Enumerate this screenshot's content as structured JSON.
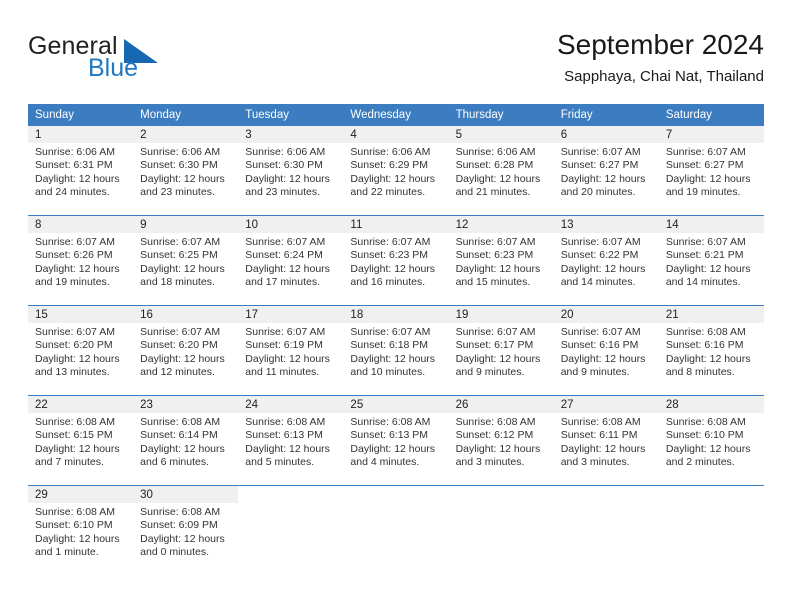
{
  "brand": {
    "name_part1": "General",
    "name_part2": "Blue",
    "accent_color": "#1668b3",
    "triangle_icon": "triangle-icon"
  },
  "header": {
    "month_title": "September 2024",
    "location": "Sapphaya, Chai Nat, Thailand"
  },
  "calendar": {
    "header_background": "#3b7dc0",
    "daynum_background": "#f0f0f0",
    "weekday_headers": [
      "Sunday",
      "Monday",
      "Tuesday",
      "Wednesday",
      "Thursday",
      "Friday",
      "Saturday"
    ],
    "weeks": [
      [
        {
          "day": "1",
          "sunrise": "Sunrise: 6:06 AM",
          "sunset": "Sunset: 6:31 PM",
          "daylight_line1": "Daylight: 12 hours",
          "daylight_line2": "and 24 minutes."
        },
        {
          "day": "2",
          "sunrise": "Sunrise: 6:06 AM",
          "sunset": "Sunset: 6:30 PM",
          "daylight_line1": "Daylight: 12 hours",
          "daylight_line2": "and 23 minutes."
        },
        {
          "day": "3",
          "sunrise": "Sunrise: 6:06 AM",
          "sunset": "Sunset: 6:30 PM",
          "daylight_line1": "Daylight: 12 hours",
          "daylight_line2": "and 23 minutes."
        },
        {
          "day": "4",
          "sunrise": "Sunrise: 6:06 AM",
          "sunset": "Sunset: 6:29 PM",
          "daylight_line1": "Daylight: 12 hours",
          "daylight_line2": "and 22 minutes."
        },
        {
          "day": "5",
          "sunrise": "Sunrise: 6:06 AM",
          "sunset": "Sunset: 6:28 PM",
          "daylight_line1": "Daylight: 12 hours",
          "daylight_line2": "and 21 minutes."
        },
        {
          "day": "6",
          "sunrise": "Sunrise: 6:07 AM",
          "sunset": "Sunset: 6:27 PM",
          "daylight_line1": "Daylight: 12 hours",
          "daylight_line2": "and 20 minutes."
        },
        {
          "day": "7",
          "sunrise": "Sunrise: 6:07 AM",
          "sunset": "Sunset: 6:27 PM",
          "daylight_line1": "Daylight: 12 hours",
          "daylight_line2": "and 19 minutes."
        }
      ],
      [
        {
          "day": "8",
          "sunrise": "Sunrise: 6:07 AM",
          "sunset": "Sunset: 6:26 PM",
          "daylight_line1": "Daylight: 12 hours",
          "daylight_line2": "and 19 minutes."
        },
        {
          "day": "9",
          "sunrise": "Sunrise: 6:07 AM",
          "sunset": "Sunset: 6:25 PM",
          "daylight_line1": "Daylight: 12 hours",
          "daylight_line2": "and 18 minutes."
        },
        {
          "day": "10",
          "sunrise": "Sunrise: 6:07 AM",
          "sunset": "Sunset: 6:24 PM",
          "daylight_line1": "Daylight: 12 hours",
          "daylight_line2": "and 17 minutes."
        },
        {
          "day": "11",
          "sunrise": "Sunrise: 6:07 AM",
          "sunset": "Sunset: 6:23 PM",
          "daylight_line1": "Daylight: 12 hours",
          "daylight_line2": "and 16 minutes."
        },
        {
          "day": "12",
          "sunrise": "Sunrise: 6:07 AM",
          "sunset": "Sunset: 6:23 PM",
          "daylight_line1": "Daylight: 12 hours",
          "daylight_line2": "and 15 minutes."
        },
        {
          "day": "13",
          "sunrise": "Sunrise: 6:07 AM",
          "sunset": "Sunset: 6:22 PM",
          "daylight_line1": "Daylight: 12 hours",
          "daylight_line2": "and 14 minutes."
        },
        {
          "day": "14",
          "sunrise": "Sunrise: 6:07 AM",
          "sunset": "Sunset: 6:21 PM",
          "daylight_line1": "Daylight: 12 hours",
          "daylight_line2": "and 14 minutes."
        }
      ],
      [
        {
          "day": "15",
          "sunrise": "Sunrise: 6:07 AM",
          "sunset": "Sunset: 6:20 PM",
          "daylight_line1": "Daylight: 12 hours",
          "daylight_line2": "and 13 minutes."
        },
        {
          "day": "16",
          "sunrise": "Sunrise: 6:07 AM",
          "sunset": "Sunset: 6:20 PM",
          "daylight_line1": "Daylight: 12 hours",
          "daylight_line2": "and 12 minutes."
        },
        {
          "day": "17",
          "sunrise": "Sunrise: 6:07 AM",
          "sunset": "Sunset: 6:19 PM",
          "daylight_line1": "Daylight: 12 hours",
          "daylight_line2": "and 11 minutes."
        },
        {
          "day": "18",
          "sunrise": "Sunrise: 6:07 AM",
          "sunset": "Sunset: 6:18 PM",
          "daylight_line1": "Daylight: 12 hours",
          "daylight_line2": "and 10 minutes."
        },
        {
          "day": "19",
          "sunrise": "Sunrise: 6:07 AM",
          "sunset": "Sunset: 6:17 PM",
          "daylight_line1": "Daylight: 12 hours",
          "daylight_line2": "and 9 minutes."
        },
        {
          "day": "20",
          "sunrise": "Sunrise: 6:07 AM",
          "sunset": "Sunset: 6:16 PM",
          "daylight_line1": "Daylight: 12 hours",
          "daylight_line2": "and 9 minutes."
        },
        {
          "day": "21",
          "sunrise": "Sunrise: 6:08 AM",
          "sunset": "Sunset: 6:16 PM",
          "daylight_line1": "Daylight: 12 hours",
          "daylight_line2": "and 8 minutes."
        }
      ],
      [
        {
          "day": "22",
          "sunrise": "Sunrise: 6:08 AM",
          "sunset": "Sunset: 6:15 PM",
          "daylight_line1": "Daylight: 12 hours",
          "daylight_line2": "and 7 minutes."
        },
        {
          "day": "23",
          "sunrise": "Sunrise: 6:08 AM",
          "sunset": "Sunset: 6:14 PM",
          "daylight_line1": "Daylight: 12 hours",
          "daylight_line2": "and 6 minutes."
        },
        {
          "day": "24",
          "sunrise": "Sunrise: 6:08 AM",
          "sunset": "Sunset: 6:13 PM",
          "daylight_line1": "Daylight: 12 hours",
          "daylight_line2": "and 5 minutes."
        },
        {
          "day": "25",
          "sunrise": "Sunrise: 6:08 AM",
          "sunset": "Sunset: 6:13 PM",
          "daylight_line1": "Daylight: 12 hours",
          "daylight_line2": "and 4 minutes."
        },
        {
          "day": "26",
          "sunrise": "Sunrise: 6:08 AM",
          "sunset": "Sunset: 6:12 PM",
          "daylight_line1": "Daylight: 12 hours",
          "daylight_line2": "and 3 minutes."
        },
        {
          "day": "27",
          "sunrise": "Sunrise: 6:08 AM",
          "sunset": "Sunset: 6:11 PM",
          "daylight_line1": "Daylight: 12 hours",
          "daylight_line2": "and 3 minutes."
        },
        {
          "day": "28",
          "sunrise": "Sunrise: 6:08 AM",
          "sunset": "Sunset: 6:10 PM",
          "daylight_line1": "Daylight: 12 hours",
          "daylight_line2": "and 2 minutes."
        }
      ],
      [
        {
          "day": "29",
          "sunrise": "Sunrise: 6:08 AM",
          "sunset": "Sunset: 6:10 PM",
          "daylight_line1": "Daylight: 12 hours",
          "daylight_line2": "and 1 minute."
        },
        {
          "day": "30",
          "sunrise": "Sunrise: 6:08 AM",
          "sunset": "Sunset: 6:09 PM",
          "daylight_line1": "Daylight: 12 hours",
          "daylight_line2": "and 0 minutes."
        },
        {
          "day": "",
          "sunrise": "",
          "sunset": "",
          "daylight_line1": "",
          "daylight_line2": ""
        },
        {
          "day": "",
          "sunrise": "",
          "sunset": "",
          "daylight_line1": "",
          "daylight_line2": ""
        },
        {
          "day": "",
          "sunrise": "",
          "sunset": "",
          "daylight_line1": "",
          "daylight_line2": ""
        },
        {
          "day": "",
          "sunrise": "",
          "sunset": "",
          "daylight_line1": "",
          "daylight_line2": ""
        },
        {
          "day": "",
          "sunrise": "",
          "sunset": "",
          "daylight_line1": "",
          "daylight_line2": ""
        }
      ]
    ]
  }
}
